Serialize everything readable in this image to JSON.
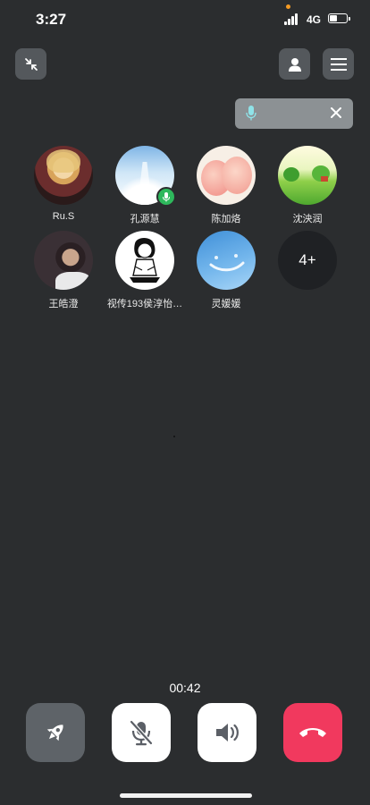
{
  "status_bar": {
    "time": "3:27",
    "network": "4G",
    "battery_level": 0.45
  },
  "call": {
    "duration": "00:42",
    "participants": [
      {
        "name": "Ru.S",
        "avatar": "woman-portrait",
        "speaking": false
      },
      {
        "name": "孔源慧",
        "avatar": "sky-stairs",
        "speaking": true
      },
      {
        "name": "陈加烙",
        "avatar": "peach",
        "speaking": false
      },
      {
        "name": "沈泱润",
        "avatar": "green-landscape",
        "speaking": false
      },
      {
        "name": "王皓澄",
        "avatar": "man-portrait",
        "speaking": false
      },
      {
        "name": "视传193侯淳怡…",
        "avatar": "cartoon-sketch",
        "speaking": false
      },
      {
        "name": "灵媛媛",
        "avatar": "blue-sky",
        "speaking": false
      }
    ],
    "more_count": "4+"
  },
  "icons": {
    "minimize": "minimize-arrows-icon",
    "contact": "person-icon",
    "menu": "hamburger-icon",
    "mic": "mic-icon",
    "close": "close-icon",
    "share": "rocket-icon",
    "mute": "mic-off-icon",
    "speaker": "speaker-icon",
    "hangup": "phone-hangup-icon"
  },
  "colors": {
    "background": "#2b2d2f",
    "hangup": "#f1395e",
    "speaking": "#2eb85c"
  }
}
